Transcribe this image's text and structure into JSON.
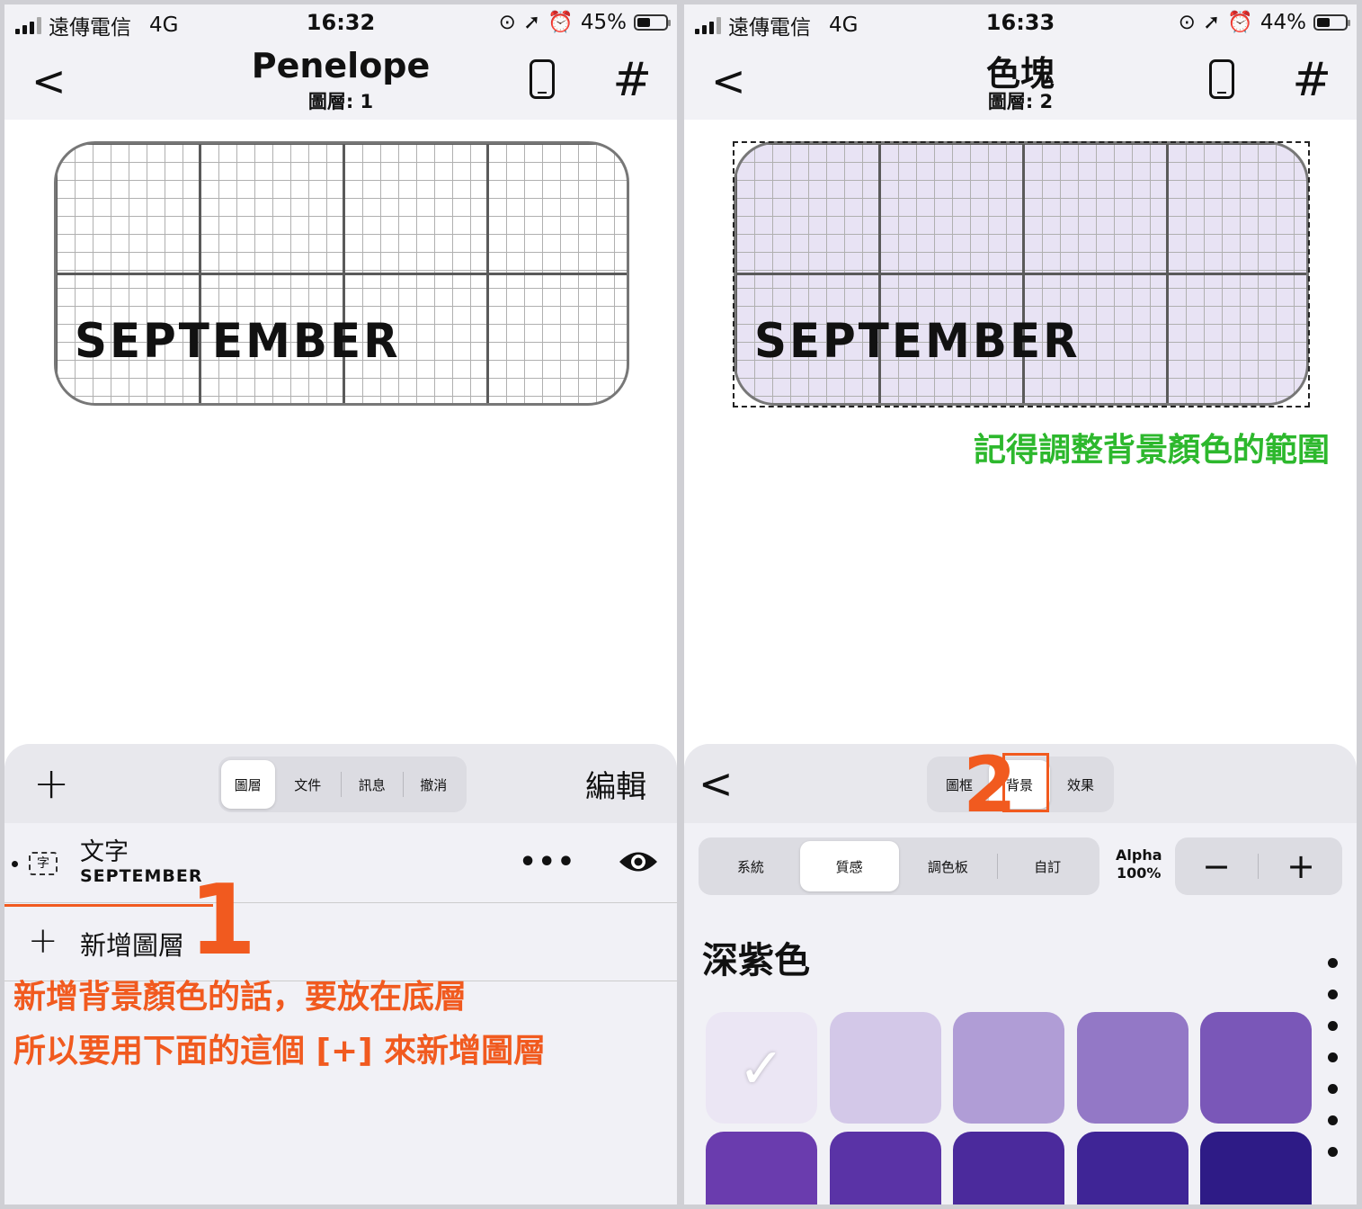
{
  "left": {
    "status": {
      "carrier": "遠傳電信",
      "network": "4G",
      "time": "16:32",
      "battery": "45%"
    },
    "nav": {
      "back": "<",
      "title": "Penelope",
      "subtitle": "圖層: 1"
    },
    "widget": {
      "text": "SEPTEMBER"
    },
    "panel": {
      "add": "+",
      "tabs": [
        "圖層",
        "文件",
        "訊息",
        "撤消"
      ],
      "edit": "編輯",
      "layer": {
        "name": "文字",
        "sub": "SEPTEMBER",
        "icon_text": "字",
        "more": "•••"
      },
      "add_layer": "新增圖層"
    },
    "annotation": {
      "number": "1",
      "line1": "新增背景顏色的話，要放在底層",
      "line2": "所以要用下面的這個 [+] 來新增圖層",
      "color": "#f15a1f"
    }
  },
  "right": {
    "status": {
      "carrier": "遠傳電信",
      "network": "4G",
      "time": "16:33",
      "battery": "44%"
    },
    "nav": {
      "back": "<",
      "title": "色塊",
      "subtitle": "圖層: 2"
    },
    "widget": {
      "text": "SEPTEMBER"
    },
    "note": "記得調整背景顏色的範圍",
    "note_color": "#2db82d",
    "panel": {
      "back": "<",
      "tabs": [
        "圖框",
        "背景",
        "效果"
      ],
      "subtabs": [
        "系統",
        "質感",
        "調色板",
        "自訂"
      ],
      "alpha_label": "Alpha",
      "alpha_value": "100%",
      "minus": "−",
      "plus": "+",
      "color_title": "深紫色",
      "swatches": [
        "#ebe6f4",
        "#d3c8e8",
        "#b09dd6",
        "#9378c6",
        "#7a57b8",
        "#6a3cae",
        "#5a33a6",
        "#4b2a9c",
        "#3f2596",
        "#2e1b86"
      ],
      "selected_index": 0,
      "check": "✓"
    },
    "annotation": {
      "number": "2"
    }
  }
}
